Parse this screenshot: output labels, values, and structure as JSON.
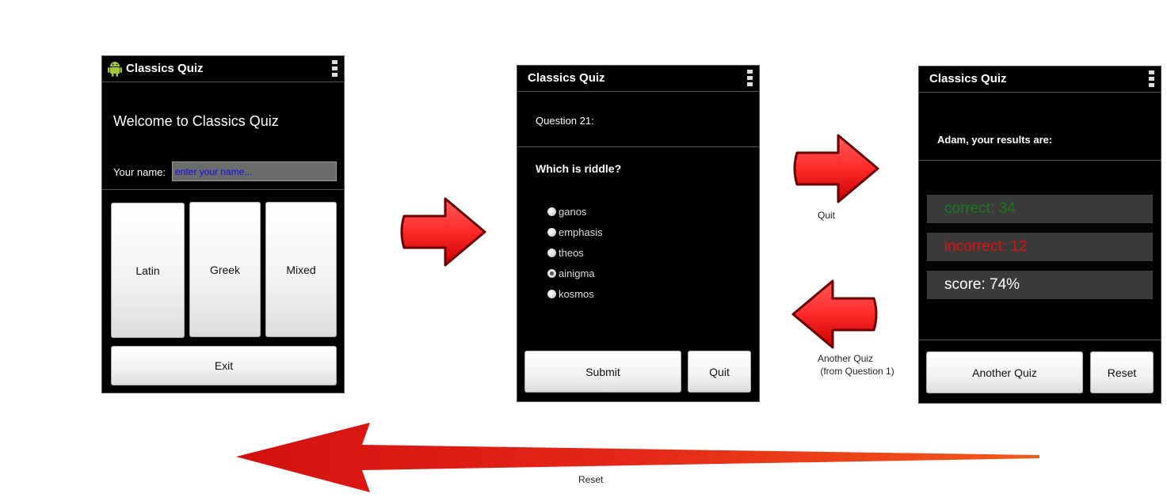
{
  "app_title": "Classics Quiz",
  "welcome_screen": {
    "welcome_text": "Welcome to Classics Quiz",
    "name_label": "Your name:",
    "name_placeholder": "enter your name...",
    "buttons": {
      "latin": "Latin",
      "greek": "Greek",
      "mixed": "Mixed",
      "exit": "Exit"
    }
  },
  "question_screen": {
    "question_number": "Question 21:",
    "question_text": "Which is riddle?",
    "options": [
      "ganos",
      "emphasis",
      "theos",
      "ainigma",
      "kosmos"
    ],
    "selected_option": "ainigma",
    "buttons": {
      "submit": "Submit",
      "quit": "Quit"
    }
  },
  "results_screen": {
    "heading": "Adam, your results are:",
    "correct": "correct: 34",
    "incorrect": "incorrect: 12",
    "score": "score: 74%",
    "buttons": {
      "another_quiz": "Another Quiz",
      "reset": "Reset"
    }
  },
  "captions": {
    "quit": "Quit",
    "another_quiz": "Another Quiz\n (from Question 1)",
    "reset": "Reset"
  },
  "colors": {
    "screen_bg": "#000000",
    "arrow_red": "#ff2a2a",
    "correct_green": "#1a7a1a",
    "incorrect_red": "#e01010",
    "input_text": "#1010ee"
  }
}
